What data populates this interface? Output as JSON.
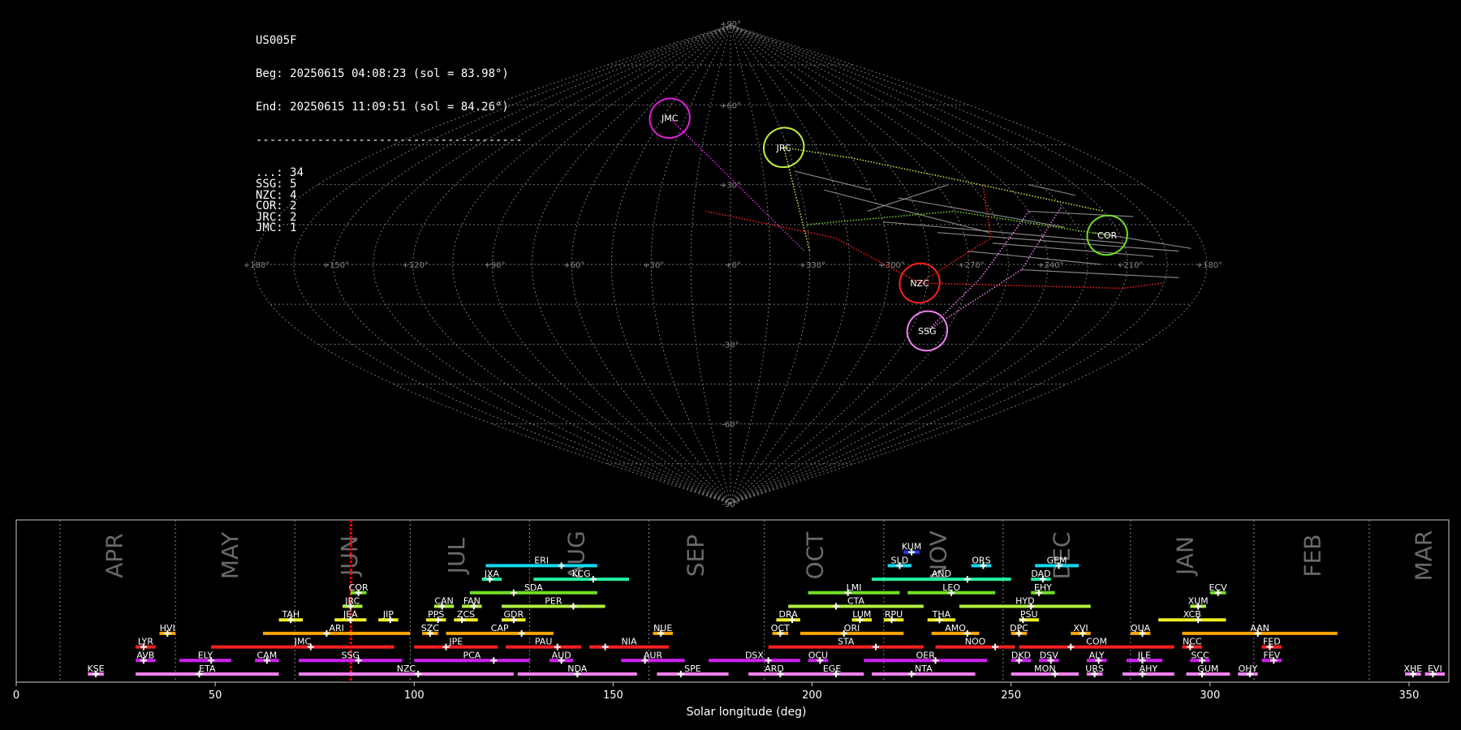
{
  "info": {
    "station": "US005F",
    "begin": "Beg: 20250615 04:08:23 (sol = 83.98°)",
    "end": "End: 20250615 11:09:51 (sol = 84.26°)",
    "separator": "---------------------------------------",
    "counts": [
      {
        "code": "...",
        "n": 34
      },
      {
        "code": "SSG",
        "n": 5
      },
      {
        "code": "NZC",
        "n": 4
      },
      {
        "code": "COR",
        "n": 2
      },
      {
        "code": "JRC",
        "n": 2
      },
      {
        "code": "JMC",
        "n": 1
      }
    ]
  },
  "colors": {
    "JMC": "#e020e0",
    "JRC": "#c0f040",
    "COR": "#70e020",
    "NZC": "#ff2020",
    "SSG": "#f080f0",
    "sporadic": "#cccccc",
    "grid": "#777777",
    "current": "#ff0000"
  },
  "sky_map": {
    "projection": "sinusoidal",
    "lon_labels": [
      "+180°",
      "+150°",
      "+120°",
      "+90°",
      "+60°",
      "+30°",
      "+0°",
      "+330°",
      "+300°",
      "+270°",
      "+240°",
      "+210°",
      "+180°"
    ],
    "lat_labels": [
      "+90°",
      "+60°",
      "+30°",
      "-30°",
      "-60°",
      "-90°"
    ],
    "radiants": [
      {
        "code": "JMC",
        "lon": 40,
        "lat": 55
      },
      {
        "code": "JRC",
        "lon": -28,
        "lat": 44
      },
      {
        "code": "COR",
        "lon": -145,
        "lat": 11
      },
      {
        "code": "NZC",
        "lon": -72,
        "lat": -7
      },
      {
        "code": "SSG",
        "lon": -82,
        "lat": -25
      }
    ]
  },
  "chart_data": {
    "type": "timeline",
    "xlabel": "Solar longitude (deg)",
    "xlim": [
      0,
      360
    ],
    "xticks": [
      0,
      50,
      100,
      150,
      200,
      250,
      300,
      350
    ],
    "current_sol": 84.1,
    "months": [
      {
        "label": "APR",
        "start": 11,
        "center": 25
      },
      {
        "label": "MAY",
        "start": 40,
        "center": 54
      },
      {
        "label": "JUN",
        "start": 70,
        "center": 84
      },
      {
        "label": "JUL",
        "start": 99,
        "center": 111
      },
      {
        "label": "AUG",
        "start": 129,
        "center": 141
      },
      {
        "label": "SEP",
        "start": 159,
        "center": 171
      },
      {
        "label": "OCT",
        "start": 188,
        "center": 201
      },
      {
        "label": "NOV",
        "start": 218,
        "center": 232
      },
      {
        "label": "DEC",
        "start": 248,
        "center": 263
      },
      {
        "label": "JAN",
        "start": 280,
        "center": 294
      },
      {
        "label": "FEB",
        "start": 311,
        "center": 326
      },
      {
        "label": "MAR",
        "start": 340,
        "center": 354
      }
    ],
    "showers": [
      {
        "code": "KUM",
        "start": 223,
        "end": 227,
        "peak": 225,
        "row": 10,
        "color": "#2040ff"
      },
      {
        "code": "ERI",
        "start": 118,
        "end": 146,
        "peak": 137,
        "row": 9,
        "color": "#10d8f0"
      },
      {
        "code": "SLD",
        "start": 219,
        "end": 225,
        "peak": 222,
        "row": 9,
        "color": "#10d8f0"
      },
      {
        "code": "ORS",
        "start": 240,
        "end": 245,
        "peak": 243,
        "row": 9,
        "color": "#10d8f0"
      },
      {
        "code": "GEM",
        "start": 256,
        "end": 267,
        "peak": 262,
        "row": 9,
        "color": "#10d8f0"
      },
      {
        "code": "JXA",
        "start": 117,
        "end": 122,
        "peak": 119,
        "row": 8,
        "color": "#20f0a0"
      },
      {
        "code": "KCG",
        "start": 130,
        "end": 154,
        "peak": 145,
        "row": 8,
        "color": "#20f0a0"
      },
      {
        "code": "AND",
        "start": 215,
        "end": 250,
        "peak": 239,
        "row": 8,
        "color": "#20f0a0"
      },
      {
        "code": "DAD",
        "start": 255,
        "end": 260,
        "peak": 258,
        "row": 8,
        "color": "#20f0a0"
      },
      {
        "code": "COR",
        "start": 84,
        "end": 88,
        "peak": 86,
        "row": 7,
        "color": "#70e020"
      },
      {
        "code": "SDA",
        "start": 114,
        "end": 146,
        "peak": 125,
        "row": 7,
        "color": "#70e020"
      },
      {
        "code": "LMI",
        "start": 199,
        "end": 222,
        "peak": 209,
        "row": 7,
        "color": "#70e020"
      },
      {
        "code": "LEO",
        "start": 224,
        "end": 246,
        "peak": 235,
        "row": 7,
        "color": "#70e020"
      },
      {
        "code": "EHY",
        "start": 255,
        "end": 261,
        "peak": 257,
        "row": 7,
        "color": "#70e020"
      },
      {
        "code": "ECV",
        "start": 300,
        "end": 304,
        "peak": 302,
        "row": 7,
        "color": "#70e020"
      },
      {
        "code": "JRC",
        "start": 82,
        "end": 87,
        "peak": 84,
        "row": 6,
        "color": "#b0f040"
      },
      {
        "code": "CAN",
        "start": 105,
        "end": 110,
        "peak": 107,
        "row": 6,
        "color": "#b0f040"
      },
      {
        "code": "FAN",
        "start": 112,
        "end": 117,
        "peak": 115,
        "row": 6,
        "color": "#b0f040"
      },
      {
        "code": "PER",
        "start": 122,
        "end": 148,
        "peak": 140,
        "row": 6,
        "color": "#b0f040"
      },
      {
        "code": "CTA",
        "start": 194,
        "end": 228,
        "peak": 206,
        "row": 6,
        "color": "#b0f040"
      },
      {
        "code": "HYD",
        "start": 237,
        "end": 270,
        "peak": 255,
        "row": 6,
        "color": "#b0f040"
      },
      {
        "code": "XUM",
        "start": 295,
        "end": 299,
        "peak": 297,
        "row": 6,
        "color": "#b0f040"
      },
      {
        "code": "TAH",
        "start": 66,
        "end": 72,
        "peak": 69,
        "row": 5,
        "color": "#f0f020"
      },
      {
        "code": "JEA",
        "start": 80,
        "end": 88,
        "peak": 84,
        "row": 5,
        "color": "#f0f020"
      },
      {
        "code": "JIP",
        "start": 91,
        "end": 96,
        "peak": 94,
        "row": 5,
        "color": "#f0f020"
      },
      {
        "code": "PPS",
        "start": 103,
        "end": 108,
        "peak": 106,
        "row": 5,
        "color": "#f0f020"
      },
      {
        "code": "ZCS",
        "start": 110,
        "end": 116,
        "peak": 112,
        "row": 5,
        "color": "#f0f020"
      },
      {
        "code": "GDR",
        "start": 122,
        "end": 128,
        "peak": 125,
        "row": 5,
        "color": "#f0f020"
      },
      {
        "code": "DRA",
        "start": 191,
        "end": 197,
        "peak": 195,
        "row": 5,
        "color": "#f0f020"
      },
      {
        "code": "LUM",
        "start": 210,
        "end": 215,
        "peak": 212,
        "row": 5,
        "color": "#f0f020"
      },
      {
        "code": "RPU",
        "start": 218,
        "end": 223,
        "peak": 220,
        "row": 5,
        "color": "#f0f020"
      },
      {
        "code": "THA",
        "start": 229,
        "end": 236,
        "peak": 232,
        "row": 5,
        "color": "#f0f020"
      },
      {
        "code": "PSU",
        "start": 252,
        "end": 257,
        "peak": 253,
        "row": 5,
        "color": "#f0f020"
      },
      {
        "code": "XCB",
        "start": 287,
        "end": 304,
        "peak": 297,
        "row": 5,
        "color": "#f0f020"
      },
      {
        "code": "HVI",
        "start": 36,
        "end": 40,
        "peak": 38,
        "row": 4,
        "color": "#ffa500"
      },
      {
        "code": "ARI",
        "start": 62,
        "end": 99,
        "peak": 78,
        "row": 4,
        "color": "#ffa500"
      },
      {
        "code": "SZC",
        "start": 102,
        "end": 106,
        "peak": 104,
        "row": 4,
        "color": "#ffa500"
      },
      {
        "code": "CAP",
        "start": 108,
        "end": 135,
        "peak": 127,
        "row": 4,
        "color": "#ffa500"
      },
      {
        "code": "NUE",
        "start": 160,
        "end": 165,
        "peak": 162,
        "row": 4,
        "color": "#ffa500"
      },
      {
        "code": "OCT",
        "start": 190,
        "end": 194,
        "peak": 192,
        "row": 4,
        "color": "#ffa500"
      },
      {
        "code": "ORI",
        "start": 197,
        "end": 223,
        "peak": 208,
        "row": 4,
        "color": "#ffa500"
      },
      {
        "code": "AMO",
        "start": 230,
        "end": 242,
        "peak": 239,
        "row": 4,
        "color": "#ffa500"
      },
      {
        "code": "DPC",
        "start": 250,
        "end": 254,
        "peak": 252,
        "row": 4,
        "color": "#ffa500"
      },
      {
        "code": "XVI",
        "start": 265,
        "end": 270,
        "peak": 268,
        "row": 4,
        "color": "#ffa500"
      },
      {
        "code": "QUA",
        "start": 280,
        "end": 285,
        "peak": 283,
        "row": 4,
        "color": "#ffa500"
      },
      {
        "code": "AAN",
        "start": 293,
        "end": 332,
        "peak": 312,
        "row": 4,
        "color": "#ffa500"
      },
      {
        "code": "LYR",
        "start": 30,
        "end": 35,
        "peak": 32,
        "row": 3,
        "color": "#ff2020"
      },
      {
        "code": "JMC",
        "start": 49,
        "end": 95,
        "peak": 74,
        "row": 3,
        "color": "#ff2020"
      },
      {
        "code": "JPE",
        "start": 100,
        "end": 121,
        "peak": 108,
        "row": 3,
        "color": "#ff2020"
      },
      {
        "code": "PAU",
        "start": 123,
        "end": 142,
        "peak": 136,
        "row": 3,
        "color": "#ff2020"
      },
      {
        "code": "NIA",
        "start": 144,
        "end": 164,
        "peak": 148,
        "row": 3,
        "color": "#ff2020"
      },
      {
        "code": "STA",
        "start": 189,
        "end": 228,
        "peak": 216,
        "row": 3,
        "color": "#ff2020"
      },
      {
        "code": "NOO",
        "start": 231,
        "end": 251,
        "peak": 246,
        "row": 3,
        "color": "#ff2020"
      },
      {
        "code": "COM",
        "start": 252,
        "end": 291,
        "peak": 265,
        "row": 3,
        "color": "#ff2020"
      },
      {
        "code": "NCC",
        "start": 293,
        "end": 298,
        "peak": 295,
        "row": 3,
        "color": "#ff2020"
      },
      {
        "code": "FED",
        "start": 313,
        "end": 318,
        "peak": 315,
        "row": 3,
        "color": "#ff2020"
      },
      {
        "code": "AVB",
        "start": 30,
        "end": 35,
        "peak": 32,
        "row": 2,
        "color": "#d020f0"
      },
      {
        "code": "ELY",
        "start": 41,
        "end": 54,
        "peak": 49,
        "row": 2,
        "color": "#d020f0"
      },
      {
        "code": "CAM",
        "start": 60,
        "end": 66,
        "peak": 63,
        "row": 2,
        "color": "#d020f0"
      },
      {
        "code": "SSG",
        "start": 71,
        "end": 97,
        "peak": 86,
        "row": 2,
        "color": "#d020f0"
      },
      {
        "code": "PCA",
        "start": 100,
        "end": 129,
        "peak": 120,
        "row": 2,
        "color": "#d020f0"
      },
      {
        "code": "AUD",
        "start": 134,
        "end": 140,
        "peak": 137,
        "row": 2,
        "color": "#d020f0"
      },
      {
        "code": "AUR",
        "start": 152,
        "end": 168,
        "peak": 158,
        "row": 2,
        "color": "#d020f0"
      },
      {
        "code": "DSX",
        "start": 174,
        "end": 197,
        "peak": 189,
        "row": 2,
        "color": "#d020f0"
      },
      {
        "code": "OCU",
        "start": 199,
        "end": 204,
        "peak": 202,
        "row": 2,
        "color": "#d020f0"
      },
      {
        "code": "OER",
        "start": 213,
        "end": 244,
        "peak": 231,
        "row": 2,
        "color": "#d020f0"
      },
      {
        "code": "DKD",
        "start": 250,
        "end": 255,
        "peak": 252,
        "row": 2,
        "color": "#d020f0"
      },
      {
        "code": "DSV",
        "start": 257,
        "end": 262,
        "peak": 260,
        "row": 2,
        "color": "#d020f0"
      },
      {
        "code": "ALY",
        "start": 269,
        "end": 274,
        "peak": 272,
        "row": 2,
        "color": "#d020f0"
      },
      {
        "code": "JLE",
        "start": 279,
        "end": 288,
        "peak": 283,
        "row": 2,
        "color": "#d020f0"
      },
      {
        "code": "SCC",
        "start": 295,
        "end": 300,
        "peak": 298,
        "row": 2,
        "color": "#d020f0"
      },
      {
        "code": "FEV",
        "start": 313,
        "end": 318,
        "peak": 316,
        "row": 2,
        "color": "#d020f0"
      },
      {
        "code": "KSE",
        "start": 18,
        "end": 22,
        "peak": 20,
        "row": 1,
        "color": "#f080f0"
      },
      {
        "code": "ETA",
        "start": 30,
        "end": 66,
        "peak": 46,
        "row": 1,
        "color": "#f080f0"
      },
      {
        "code": "NZC",
        "start": 71,
        "end": 125,
        "peak": 101,
        "row": 1,
        "color": "#f080f0"
      },
      {
        "code": "NDA",
        "start": 126,
        "end": 156,
        "peak": 141,
        "row": 1,
        "color": "#f080f0"
      },
      {
        "code": "SPE",
        "start": 161,
        "end": 179,
        "peak": 167,
        "row": 1,
        "color": "#f080f0"
      },
      {
        "code": "ARD",
        "start": 184,
        "end": 197,
        "peak": 192,
        "row": 1,
        "color": "#f080f0"
      },
      {
        "code": "EGE",
        "start": 197,
        "end": 213,
        "peak": 206,
        "row": 1,
        "color": "#f080f0"
      },
      {
        "code": "NTA",
        "start": 215,
        "end": 241,
        "peak": 225,
        "row": 1,
        "color": "#f080f0"
      },
      {
        "code": "MON",
        "start": 250,
        "end": 267,
        "peak": 261,
        "row": 1,
        "color": "#f080f0"
      },
      {
        "code": "URS",
        "start": 269,
        "end": 273,
        "peak": 271,
        "row": 1,
        "color": "#f080f0"
      },
      {
        "code": "AHY",
        "start": 278,
        "end": 291,
        "peak": 283,
        "row": 1,
        "color": "#f080f0"
      },
      {
        "code": "GUM",
        "start": 294,
        "end": 305,
        "peak": 298,
        "row": 1,
        "color": "#f080f0"
      },
      {
        "code": "OHY",
        "start": 307,
        "end": 312,
        "peak": 310,
        "row": 1,
        "color": "#f080f0"
      },
      {
        "code": "XHE",
        "start": 349,
        "end": 353,
        "peak": 351,
        "row": 1,
        "color": "#f080f0"
      },
      {
        "code": "EVI",
        "start": 354,
        "end": 359,
        "peak": 356,
        "row": 1,
        "color": "#f080f0"
      }
    ]
  }
}
